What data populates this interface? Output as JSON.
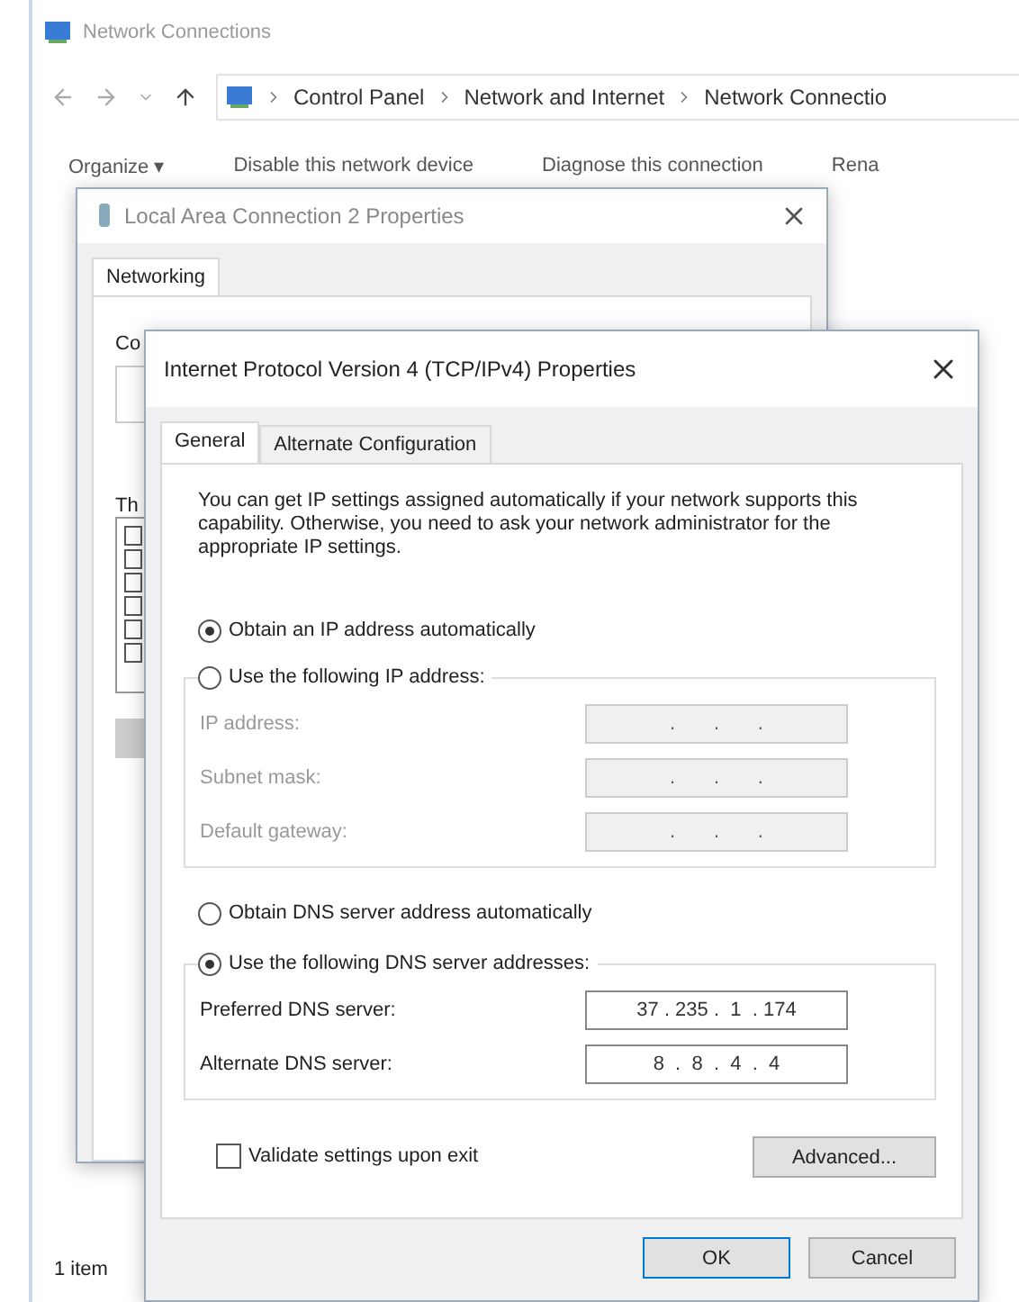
{
  "explorer": {
    "title": "Network Connections",
    "breadcrumb": [
      "Control Panel",
      "Network and Internet",
      "Network Connectio"
    ],
    "toolbar": [
      "Organize ▾",
      "Disable this network device",
      "Diagnose this connection",
      "Rena"
    ],
    "status": "1 item"
  },
  "lan_dialog": {
    "title": "Local Area Connection 2 Properties",
    "tabs": [
      {
        "label": "Networking",
        "selected": true
      }
    ],
    "labels": [
      "Co",
      "Th"
    ]
  },
  "ipv4_dialog": {
    "title": "Internet Protocol Version 4 (TCP/IPv4) Properties",
    "tabs": [
      {
        "label": "General",
        "selected": true
      },
      {
        "label": "Alternate Configuration",
        "selected": false
      }
    ],
    "intro": "You can get IP settings assigned automatically if your network supports this capability. Otherwise, you need to ask your network administrator for the appropriate IP settings.",
    "ip_mode": [
      {
        "label": "Obtain an IP address automatically",
        "selected": true
      },
      {
        "label": "Use the following IP address:",
        "selected": false
      }
    ],
    "ip_fields": [
      {
        "label": "IP address:",
        "value": ".       .       .",
        "disabled": true
      },
      {
        "label": "Subnet mask:",
        "value": ".       .       .",
        "disabled": true
      },
      {
        "label": "Default gateway:",
        "value": ".       .       .",
        "disabled": true
      }
    ],
    "dns_mode": [
      {
        "label": "Obtain DNS server address automatically",
        "selected": false
      },
      {
        "label": "Use the following DNS server addresses:",
        "selected": true
      }
    ],
    "dns_fields": [
      {
        "label": "Preferred DNS server:",
        "value": "37 . 235 .  1  . 174",
        "disabled": false
      },
      {
        "label": "Alternate DNS server:",
        "value": "8  .  8  .  4  .  4",
        "disabled": false
      }
    ],
    "validate": {
      "label": "Validate settings upon exit",
      "checked": false
    },
    "advanced": "Advanced...",
    "buttons": [
      {
        "label": "OK",
        "default": true
      },
      {
        "label": "Cancel",
        "default": false
      }
    ]
  }
}
